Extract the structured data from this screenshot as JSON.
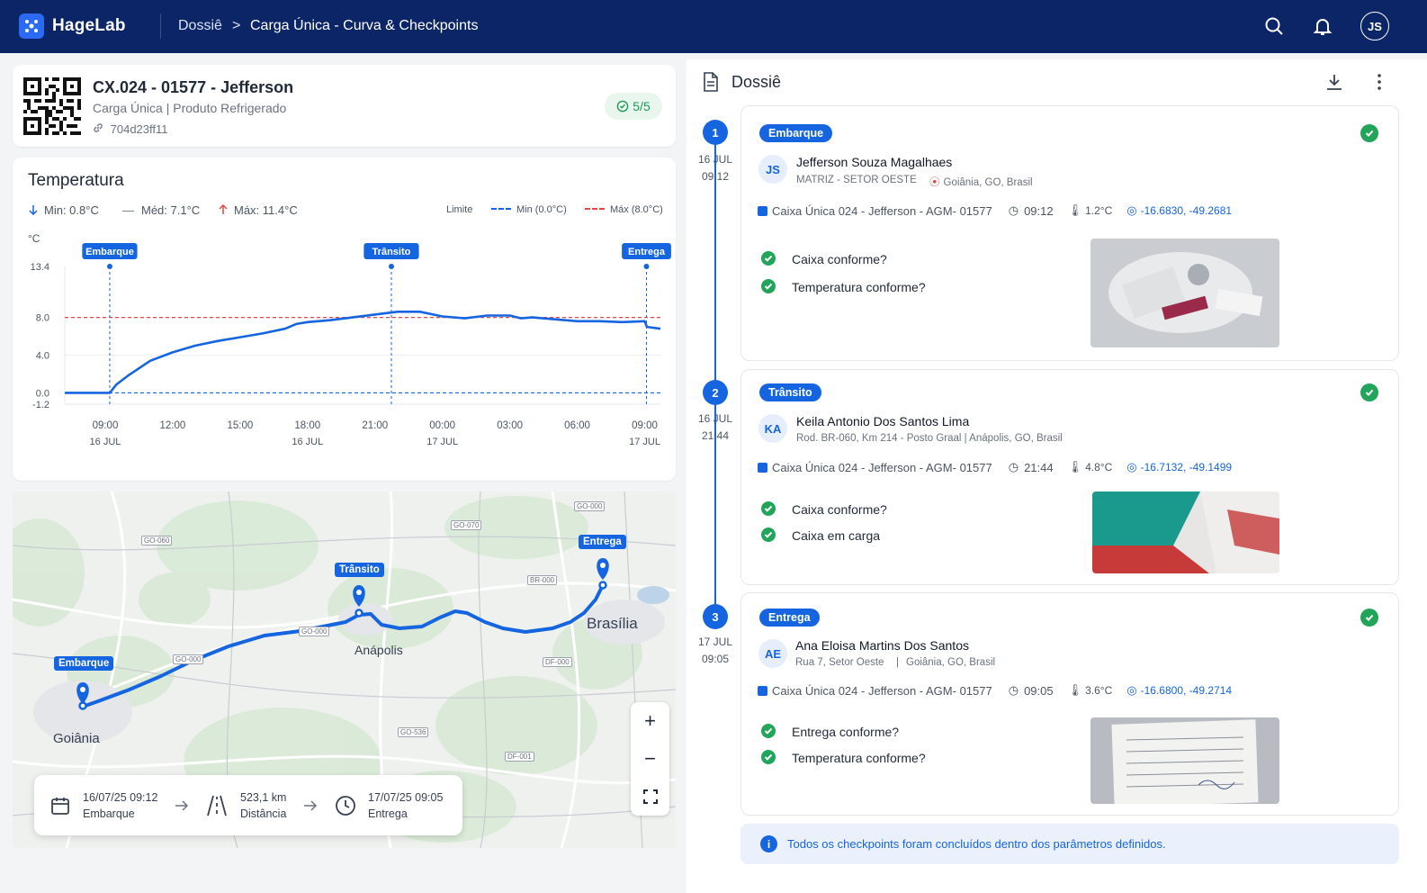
{
  "topbar": {
    "brand": "HageLab",
    "breadcrumb": [
      "Dossiê",
      "Carga Única - Curva & Checkpoints"
    ],
    "separator": ">",
    "avatar": "JS"
  },
  "load": {
    "title": "CX.024 - 01577 - Jefferson",
    "subtitle": "Carga Única | Produto Refrigerado",
    "hash": "704d23ff11",
    "badge": "5/5"
  },
  "temperature": {
    "title": "Temperatura",
    "min": "Min: 0.8°C",
    "avg": "Méd: 7.1°C",
    "max": "Máx: 11.4°C",
    "legend": {
      "label": "Limite",
      "min": "Min (0.0°C)",
      "max": "Máx (8.0°C)"
    },
    "unit": "°C"
  },
  "chart_data": {
    "type": "line",
    "title": "Temperatura",
    "ylabel": "°C",
    "ylim": [
      -1.2,
      13.4
    ],
    "yticks": [
      "13.4",
      "8.0",
      "4.0",
      "0.0",
      "-1.2"
    ],
    "xticks": [
      {
        "t": "09:00",
        "d": "16 JUL",
        "h": 9
      },
      {
        "t": "12:00",
        "d": "",
        "h": 12
      },
      {
        "t": "15:00",
        "d": "",
        "h": 15
      },
      {
        "t": "18:00",
        "d": "16 JUL",
        "h": 18
      },
      {
        "t": "21:00",
        "d": "",
        "h": 21
      },
      {
        "t": "00:00",
        "d": "17 JUL",
        "h": 24
      },
      {
        "t": "03:00",
        "d": "",
        "h": 27
      },
      {
        "t": "06:00",
        "d": "",
        "h": 30
      },
      {
        "t": "09:00",
        "d": "17 JUL",
        "h": 33
      }
    ],
    "xrange_hours": [
      7.2,
      33.7
    ],
    "limits": {
      "min": 0.0,
      "max": 8.0
    },
    "markers": [
      {
        "label": "Embarque",
        "h": 9.2
      },
      {
        "label": "Trânsito",
        "h": 21.73
      },
      {
        "label": "Entrega",
        "h": 33.08
      }
    ],
    "series": [
      {
        "x": [
          7.2,
          8,
          9,
          9.2,
          9.5,
          10,
          10.5,
          11,
          12,
          13,
          14,
          15,
          16,
          17,
          17.5,
          18,
          19,
          20,
          21,
          22,
          22.5,
          23,
          24,
          25,
          26,
          27,
          27.5,
          28,
          29,
          30,
          31,
          32,
          33,
          33.1,
          33.7
        ],
        "y": [
          0.0,
          0.0,
          0.0,
          0.0,
          0.9,
          1.8,
          2.6,
          3.4,
          4.3,
          5.0,
          5.5,
          5.9,
          6.3,
          6.8,
          7.3,
          7.5,
          7.7,
          8.0,
          8.3,
          8.6,
          8.6,
          8.6,
          8.1,
          7.9,
          8.2,
          8.2,
          7.9,
          8.0,
          7.8,
          7.6,
          7.6,
          7.5,
          7.6,
          7.0,
          6.8
        ]
      }
    ]
  },
  "map": {
    "cities": {
      "goiania": "Goiânia",
      "anapolis": "Anápolis",
      "brasilia": "Brasília"
    },
    "roads": [
      "GO-060",
      "GO-070",
      "GO-000",
      "BR-000",
      "GO-000",
      "DF-000",
      "GO-536",
      "DF-001",
      "GO-000"
    ],
    "pins": {
      "a": "Embarque",
      "b": "Trânsito",
      "c": "Entrega"
    },
    "zoom_in": "+",
    "zoom_out": "−"
  },
  "trip": {
    "start_value": "16/07/25 09:12",
    "start_label": "Embarque",
    "dist_value": "523,1 km",
    "dist_label": "Distância",
    "end_value": "17/07/25 09:05",
    "end_label": "Entrega"
  },
  "dossie": {
    "title": "Dossiê"
  },
  "checkpoints": [
    {
      "n": "1",
      "date": "16 JUL",
      "time": "09:12",
      "tag": "Embarque",
      "initials": "JS",
      "name": "Jefferson Souza Magalhaes",
      "org": "MATRIZ - SETOR OESTE",
      "place": "Goiânia, GO, Brasil",
      "box": "Caixa Única 024 - Jefferson - AGM- 01577",
      "clock": "09:12",
      "temp": "1.2°C",
      "coord": "-16.6830, -49.2681",
      "q1": "Caixa conforme?",
      "q2": "Temperatura conforme?"
    },
    {
      "n": "2",
      "date": "16 JUL",
      "time": "21:44",
      "tag": "Trânsito",
      "initials": "KA",
      "name": "Keila Antonio Dos Santos Lima",
      "org": "Rod. BR-060, Km 214 - Posto Graal | Anápolis, GO, Brasil",
      "place": "",
      "box": "Caixa Única 024 - Jefferson - AGM- 01577",
      "clock": "21:44",
      "temp": "4.8°C",
      "coord": "-16.7132, -49.1499",
      "q1": "Caixa conforme?",
      "q2": "Caixa em carga"
    },
    {
      "n": "3",
      "date": "17 JUL",
      "time": "09:05",
      "tag": "Entrega",
      "initials": "AE",
      "name": "Ana Eloisa Martins Dos Santos",
      "org": "Rua 7, Setor Oeste",
      "place": "Goiânia, GO, Brasil",
      "box": "Caixa Única 024 - Jefferson - AGM- 01577",
      "clock": "09:05",
      "temp": "3.6°C",
      "coord": "-16.6800, -49.2714",
      "q1": "Entrega conforme?",
      "q2": "Temperatura conforme?"
    }
  ],
  "info": "Todos os checkpoints foram concluídos dentro dos parâmetros definidos.",
  "colors": {
    "navy": "#0b2566",
    "accent": "#1565e0",
    "success": "#22a45a",
    "danger": "#e04848"
  }
}
